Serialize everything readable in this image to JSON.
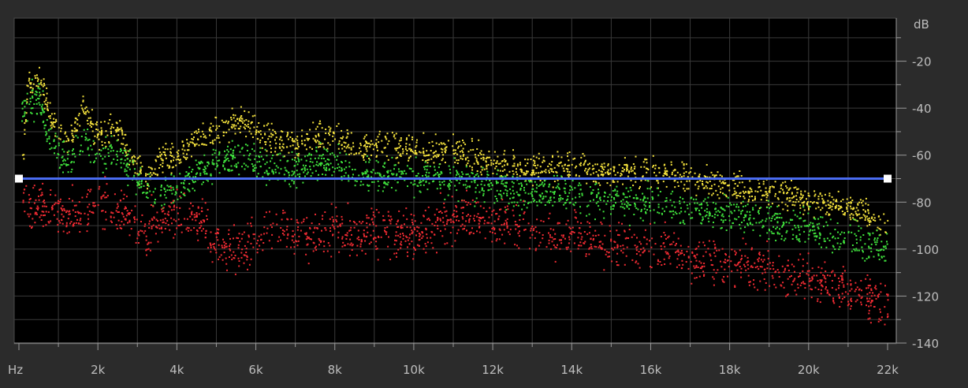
{
  "chart_data": {
    "type": "scatter",
    "title": "",
    "x_unit_label": "Hz",
    "y_unit_label": "dB",
    "xlim": [
      0,
      22000
    ],
    "ylim": [
      -140,
      -2
    ],
    "x_ticks": [
      {
        "value": 2000,
        "label": "2k"
      },
      {
        "value": 4000,
        "label": "4k"
      },
      {
        "value": 6000,
        "label": "6k"
      },
      {
        "value": 8000,
        "label": "8k"
      },
      {
        "value": 10000,
        "label": "10k"
      },
      {
        "value": 12000,
        "label": "12k"
      },
      {
        "value": 14000,
        "label": "14k"
      },
      {
        "value": 16000,
        "label": "16k"
      },
      {
        "value": 18000,
        "label": "18k"
      },
      {
        "value": 20000,
        "label": "20k"
      },
      {
        "value": 22000,
        "label": "22k"
      }
    ],
    "y_ticks": [
      {
        "value": -20,
        "label": "-20"
      },
      {
        "value": -40,
        "label": "-40"
      },
      {
        "value": -60,
        "label": "-60"
      },
      {
        "value": -80,
        "label": "-80"
      },
      {
        "value": -100,
        "label": "-100"
      },
      {
        "value": -120,
        "label": "-120"
      },
      {
        "value": -140,
        "label": "-140"
      }
    ],
    "grid": true,
    "threshold_line": {
      "value_db": -70,
      "color": "#4a6cf2"
    },
    "series": [
      {
        "color": "#f2e03c",
        "envelope": [
          [
            0,
            -85
          ],
          [
            200,
            -30
          ],
          [
            500,
            -26
          ],
          [
            800,
            -44
          ],
          [
            1200,
            -55
          ],
          [
            1600,
            -40
          ],
          [
            2000,
            -52
          ],
          [
            2400,
            -46
          ],
          [
            2800,
            -60
          ],
          [
            3200,
            -70
          ],
          [
            3600,
            -62
          ],
          [
            4000,
            -60
          ],
          [
            4500,
            -53
          ],
          [
            5000,
            -50
          ],
          [
            5500,
            -45
          ],
          [
            6000,
            -50
          ],
          [
            6500,
            -53
          ],
          [
            7000,
            -55
          ],
          [
            7500,
            -52
          ],
          [
            8000,
            -52
          ],
          [
            8500,
            -57
          ],
          [
            9000,
            -56
          ],
          [
            9500,
            -56
          ],
          [
            10000,
            -58
          ],
          [
            11000,
            -58
          ],
          [
            12000,
            -63
          ],
          [
            13000,
            -66
          ],
          [
            14000,
            -65
          ],
          [
            15000,
            -67
          ],
          [
            16000,
            -67
          ],
          [
            17000,
            -69
          ],
          [
            18000,
            -73
          ],
          [
            19000,
            -75
          ],
          [
            20000,
            -79
          ],
          [
            21000,
            -82
          ],
          [
            22000,
            -90
          ]
        ],
        "spread_db": 5
      },
      {
        "color": "#3fe03c",
        "envelope": [
          [
            0,
            -45
          ],
          [
            200,
            -38
          ],
          [
            500,
            -35
          ],
          [
            800,
            -55
          ],
          [
            1200,
            -65
          ],
          [
            1600,
            -53
          ],
          [
            2000,
            -62
          ],
          [
            2400,
            -58
          ],
          [
            2800,
            -65
          ],
          [
            3200,
            -75
          ],
          [
            3600,
            -76
          ],
          [
            4000,
            -74
          ],
          [
            4500,
            -68
          ],
          [
            5000,
            -62
          ],
          [
            5500,
            -61
          ],
          [
            6000,
            -63
          ],
          [
            6500,
            -66
          ],
          [
            7000,
            -66
          ],
          [
            7500,
            -64
          ],
          [
            8000,
            -63
          ],
          [
            8500,
            -68
          ],
          [
            9000,
            -68
          ],
          [
            9500,
            -67
          ],
          [
            10000,
            -69
          ],
          [
            11000,
            -70
          ],
          [
            12000,
            -74
          ],
          [
            13000,
            -76
          ],
          [
            14000,
            -76
          ],
          [
            15000,
            -79
          ],
          [
            16000,
            -80
          ],
          [
            17000,
            -82
          ],
          [
            18000,
            -85
          ],
          [
            19000,
            -88
          ],
          [
            20000,
            -91
          ],
          [
            21000,
            -95
          ],
          [
            22000,
            -100
          ]
        ],
        "spread_db": 6
      },
      {
        "color": "#ee2b32",
        "envelope": [
          [
            0,
            -80
          ],
          [
            300,
            -80
          ],
          [
            700,
            -82
          ],
          [
            1200,
            -86
          ],
          [
            1600,
            -84
          ],
          [
            2000,
            -80
          ],
          [
            2400,
            -82
          ],
          [
            2800,
            -88
          ],
          [
            3200,
            -93
          ],
          [
            3600,
            -86
          ],
          [
            4000,
            -86
          ],
          [
            4500,
            -86
          ],
          [
            5000,
            -98
          ],
          [
            5500,
            -100
          ],
          [
            6000,
            -97
          ],
          [
            6500,
            -90
          ],
          [
            7000,
            -93
          ],
          [
            7500,
            -95
          ],
          [
            8000,
            -90
          ],
          [
            8500,
            -92
          ],
          [
            9000,
            -91
          ],
          [
            9500,
            -93
          ],
          [
            10000,
            -93
          ],
          [
            11000,
            -88
          ],
          [
            11500,
            -84
          ],
          [
            12000,
            -88
          ],
          [
            13000,
            -92
          ],
          [
            14000,
            -94
          ],
          [
            15000,
            -98
          ],
          [
            16000,
            -100
          ],
          [
            17000,
            -103
          ],
          [
            18000,
            -106
          ],
          [
            19000,
            -108
          ],
          [
            20000,
            -112
          ],
          [
            21000,
            -117
          ],
          [
            22000,
            -124
          ]
        ],
        "spread_db": 8
      }
    ]
  }
}
